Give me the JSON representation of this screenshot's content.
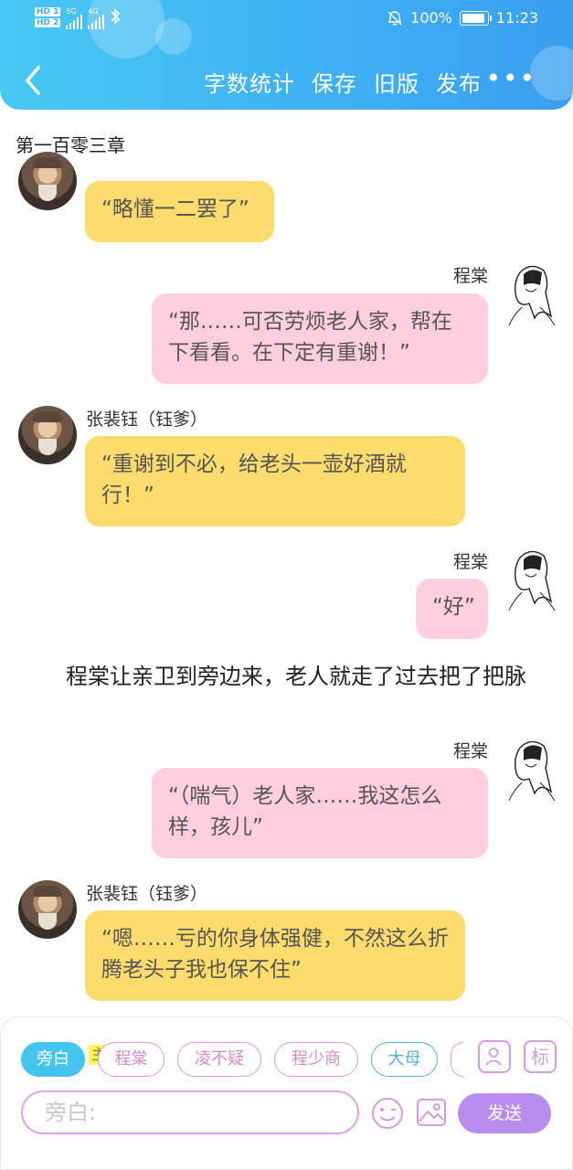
{
  "status_bar": {
    "sim1": "HD 1",
    "sim2": "HD 2",
    "net1": "5G",
    "net2": "4G",
    "battery_pct": "100%",
    "battery_level": 1.0,
    "time": "11:23"
  },
  "header": {
    "menu": [
      "字数统计",
      "保存",
      "旧版",
      "发布"
    ],
    "more": "•••"
  },
  "chapter_title": "第一百零三章",
  "messages": [
    {
      "speaker": "",
      "side": "left",
      "text": "“略懂一二罢了”"
    },
    {
      "speaker": "程棠",
      "side": "right",
      "text": "“那……可否劳烦老人家，帮在下看看。在下定有重谢！”"
    },
    {
      "speaker": "张裴钰（钰爹）",
      "side": "left",
      "text": "“重谢到不必，给老头一壶好酒就行！”"
    },
    {
      "speaker": "程棠",
      "side": "right",
      "text": "“好”"
    },
    {
      "speaker": "程棠",
      "side": "right",
      "text": "“（喘气）老人家……我这怎么样，孩儿”"
    },
    {
      "speaker": "张裴钰（钰爹）",
      "side": "left",
      "text": "“嗯……亏的你身体强健，不然这么折腾老头子我也保不住”"
    }
  ],
  "narration": "程棠让亲卫到旁边来，老人就走了过去把了把脉",
  "composer": {
    "roles": [
      "旁白",
      "程棠",
      "凌不疑",
      "程少商",
      "大母"
    ],
    "main_tag": "主",
    "tool_mark": "标",
    "input_placeholder": "旁白:",
    "send_label": "发送"
  },
  "colors": {
    "header": "#3fb4f4",
    "yellow_bubble": "#fddc6e",
    "pink_bubble": "#ffcfdc",
    "send": "#b98df0",
    "active_chip": "#45c4f0"
  }
}
